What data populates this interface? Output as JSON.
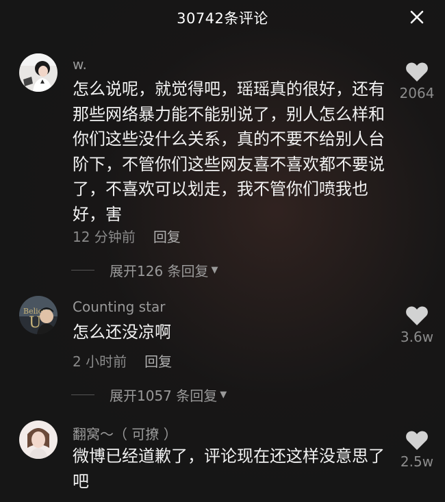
{
  "header": {
    "title": "30742条评论"
  },
  "comments": [
    {
      "username": "w.",
      "text": "怎么说呢，就觉得吧，瑶瑶真的很好，还有那些网络暴力能不能别说了，别人怎么样和你们这些没什么关系，真的不要不给别人台阶下，不管你们这些网友喜不喜欢都不要说了，不喜欢可以划走，我不管你们喷我也好，害",
      "time": "12 分钟前",
      "reply_label": "回复",
      "likes": "2064",
      "expand_label": "展开126 条回复"
    },
    {
      "username": "Counting star",
      "text": "怎么还没凉啊",
      "time": "2 小时前",
      "reply_label": "回复",
      "likes": "3.6w",
      "expand_label": "展开1057 条回复"
    },
    {
      "username": "翻窝～（  可撩  ）",
      "text": "微博已经道歉了，评论现在还这样没意思了吧",
      "time": "",
      "reply_label": "",
      "likes": "2.5w"
    }
  ],
  "colors": {
    "background": "#161616",
    "text": "#f2f2f2",
    "secondary": "#9a9a9a",
    "heart": "#d2d2d2"
  },
  "icons": {
    "close": "close-icon",
    "like": "heart-icon",
    "expand": "caret-down-icon"
  }
}
